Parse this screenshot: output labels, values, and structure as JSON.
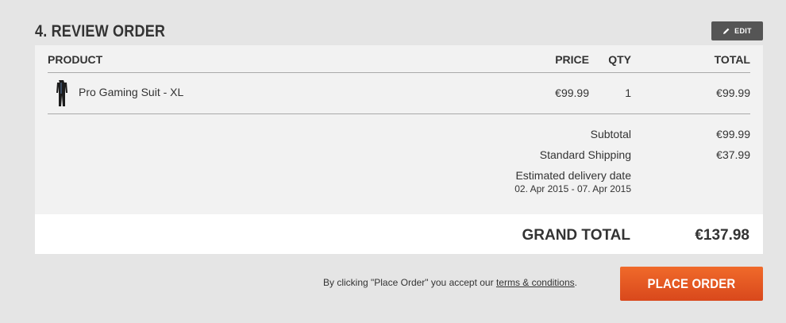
{
  "review": {
    "title": "4. REVIEW ORDER",
    "edit_label": "EDIT"
  },
  "table": {
    "headers": {
      "product": "PRODUCT",
      "price": "PRICE",
      "qty": "QTY",
      "total": "TOTAL"
    },
    "items": [
      {
        "name": "Pro Gaming Suit - XL",
        "price": "€99.99",
        "qty": "1",
        "total": "€99.99"
      }
    ]
  },
  "summary": {
    "subtotal_label": "Subtotal",
    "subtotal_value": "€99.99",
    "shipping_label": "Standard Shipping",
    "shipping_value": "€37.99",
    "delivery_label": "Estimated delivery date",
    "delivery_range": "02. Apr 2015 - 07. Apr 2015"
  },
  "grand_total": {
    "label": "GRAND TOTAL",
    "value": "€137.98"
  },
  "footer": {
    "terms_prefix": "By clicking \"Place Order\" you accept our ",
    "terms_link": "terms & conditions",
    "terms_suffix": ".",
    "place_order_label": "PLACE ORDER"
  },
  "colors": {
    "accent": "#e05a22",
    "edit_button": "#555555"
  }
}
